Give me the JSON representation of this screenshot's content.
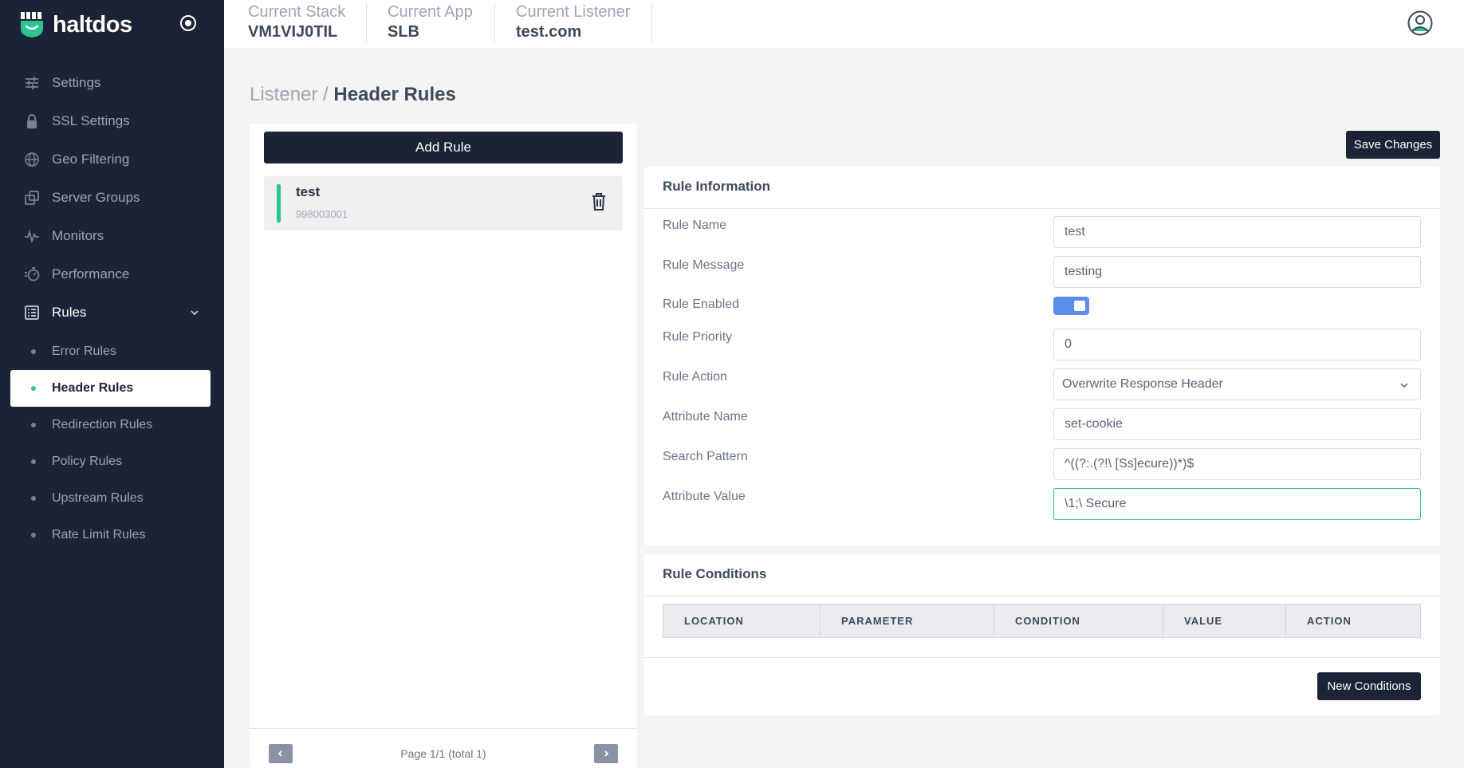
{
  "brand": {
    "name": "haltdos"
  },
  "sidebar": {
    "items": [
      {
        "label": "Settings",
        "icon": "sliders-icon"
      },
      {
        "label": "SSL Settings",
        "icon": "lock-icon"
      },
      {
        "label": "Geo Filtering",
        "icon": "globe-icon"
      },
      {
        "label": "Server Groups",
        "icon": "copy-icon"
      },
      {
        "label": "Monitors",
        "icon": "activity-icon"
      },
      {
        "label": "Performance",
        "icon": "speedometer-icon"
      },
      {
        "label": "Rules",
        "icon": "list-icon"
      }
    ],
    "rules_submenu": [
      {
        "label": "Error Rules"
      },
      {
        "label": "Header Rules",
        "active": true
      },
      {
        "label": "Redirection Rules"
      },
      {
        "label": "Policy Rules"
      },
      {
        "label": "Upstream Rules"
      },
      {
        "label": "Rate Limit Rules"
      }
    ]
  },
  "topbar": {
    "stack_label": "Current Stack",
    "stack_value": "VM1VIJ0TIL",
    "app_label": "Current App",
    "app_value": "SLB",
    "listener_label": "Current Listener",
    "listener_value": "test.com"
  },
  "breadcrumb": {
    "parent": "Listener",
    "separator": " / ",
    "current": "Header Rules"
  },
  "rules_panel": {
    "add_rule_label": "Add Rule",
    "rules": [
      {
        "name": "test",
        "id": "998003001"
      }
    ],
    "pagination": "Page 1/1 (total 1)"
  },
  "save_label": "Save Changes",
  "rule_info": {
    "title": "Rule Information",
    "fields": {
      "name_label": "Rule Name",
      "name_value": "test",
      "message_label": "Rule Message",
      "message_value": "testing",
      "enabled_label": "Rule Enabled",
      "enabled": true,
      "priority_label": "Rule Priority",
      "priority_value": "0",
      "action_label": "Rule Action",
      "action_value": "Overwrite Response Header",
      "attr_name_label": "Attribute Name",
      "attr_name_value": "set-cookie",
      "pattern_label": "Search Pattern",
      "pattern_value": "^((?:.(?!\\ [Ss]ecure))*)$",
      "attr_value_label": "Attribute Value",
      "attr_value_value": "\\1;\\ Secure"
    }
  },
  "rule_conditions": {
    "title": "Rule Conditions",
    "columns": [
      "LOCATION",
      "PARAMETER",
      "CONDITION",
      "VALUE",
      "ACTION"
    ],
    "new_label": "New Conditions"
  },
  "colors": {
    "sidebar": "#1b2336",
    "accent": "#2fc48d",
    "toggle": "#5b8def"
  }
}
